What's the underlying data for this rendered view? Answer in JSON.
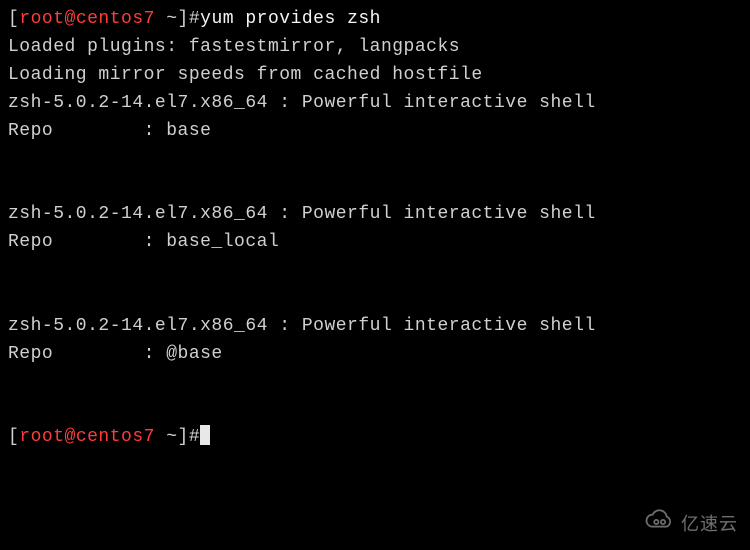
{
  "prompt": {
    "open": "[",
    "user_host": "root@centos7",
    "tilde": " ~",
    "close": "]#",
    "command": "yum provides zsh"
  },
  "output": {
    "loaded_plugins": "Loaded plugins: fastestmirror, langpacks",
    "loading_mirror": "Loading mirror speeds from cached hostfile",
    "pkg_line": "zsh-5.0.2-14.el7.x86_64 : Powerful interactive shell",
    "repo_base": "Repo        : base",
    "repo_base_local": "Repo        : base_local",
    "repo_at_base": "Repo        : @base"
  },
  "watermark": {
    "text": "亿速云"
  }
}
